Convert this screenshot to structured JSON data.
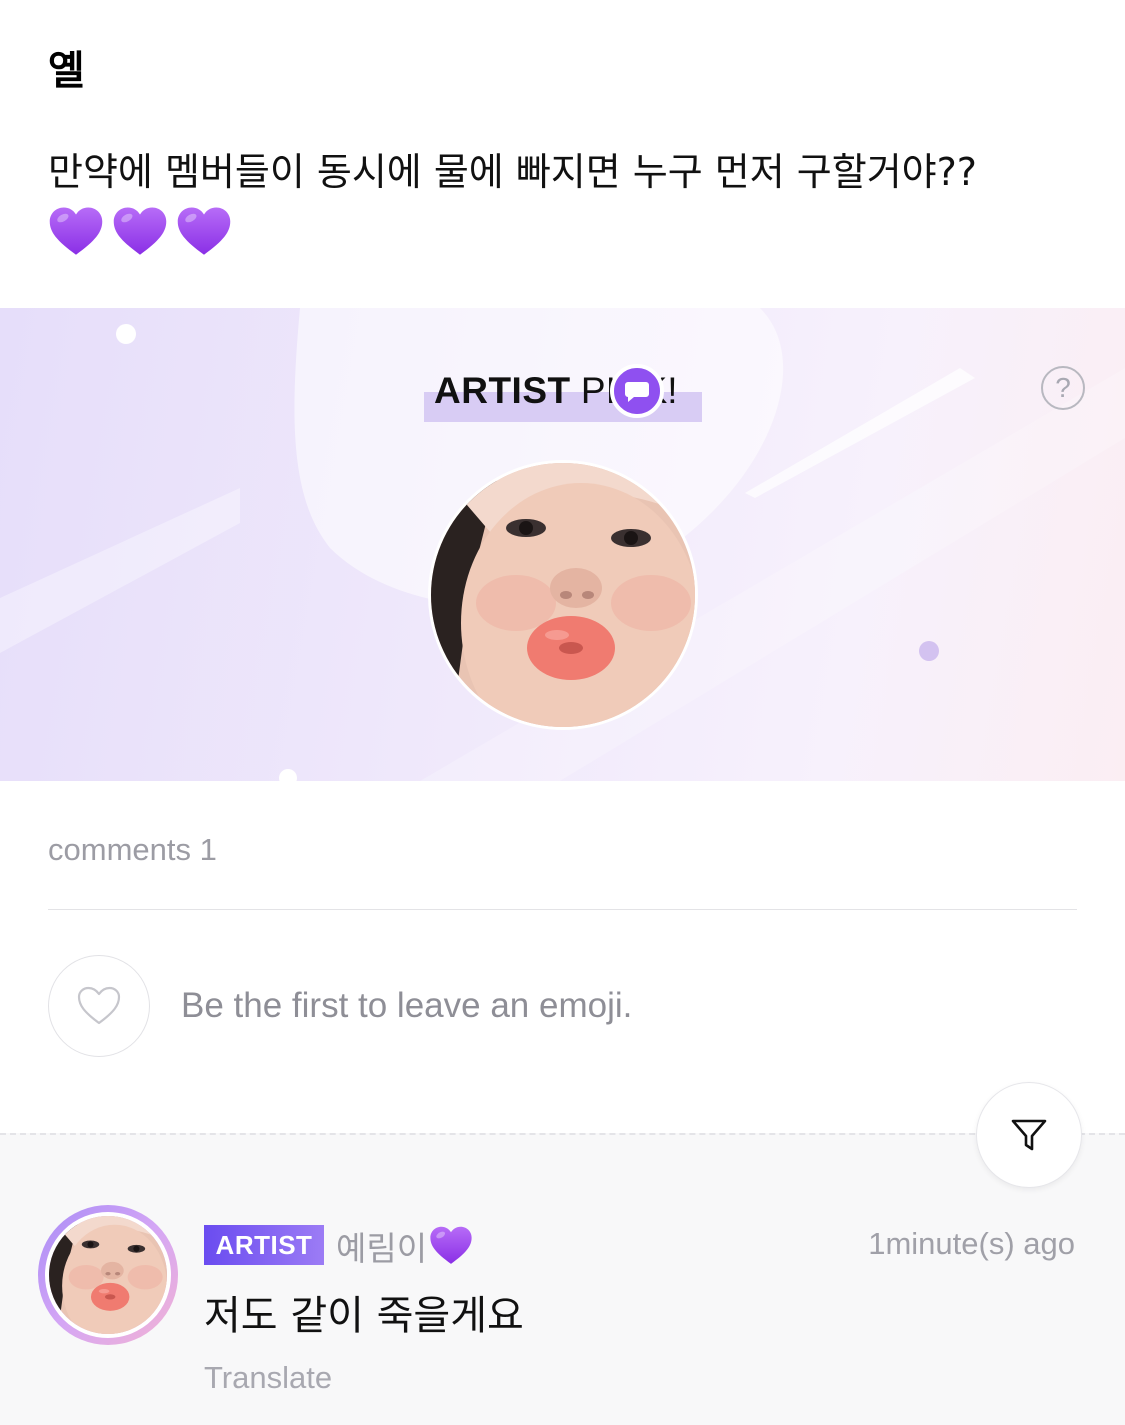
{
  "post": {
    "author": "옐",
    "body": "만약에 멤버들이 동시에 물에 빠지면 누구 먼저 구할거야??",
    "emoji_icons": [
      "purple-heart-icon",
      "purple-heart-icon",
      "purple-heart-icon"
    ]
  },
  "artist_pick": {
    "title_bold": "ARTIST",
    "title_rest": " PICK!",
    "help_icon": "?",
    "badge_icon": "chat-bubble-icon"
  },
  "comments": {
    "count_label": "comments 1",
    "emoji_prompt": "Be the first to leave an emoji.",
    "filter_icon": "filter-icon",
    "items": [
      {
        "badge": "ARTIST",
        "author": "예림이",
        "author_emoji": "purple-heart-icon",
        "time": "1minute(s) ago",
        "text": "저도 같이 죽을게요",
        "translate_label": "Translate"
      }
    ]
  },
  "colors": {
    "accent_purple": "#8f50f0",
    "heart_purple": "#a24ff0",
    "muted_text": "#9c9ca4"
  }
}
